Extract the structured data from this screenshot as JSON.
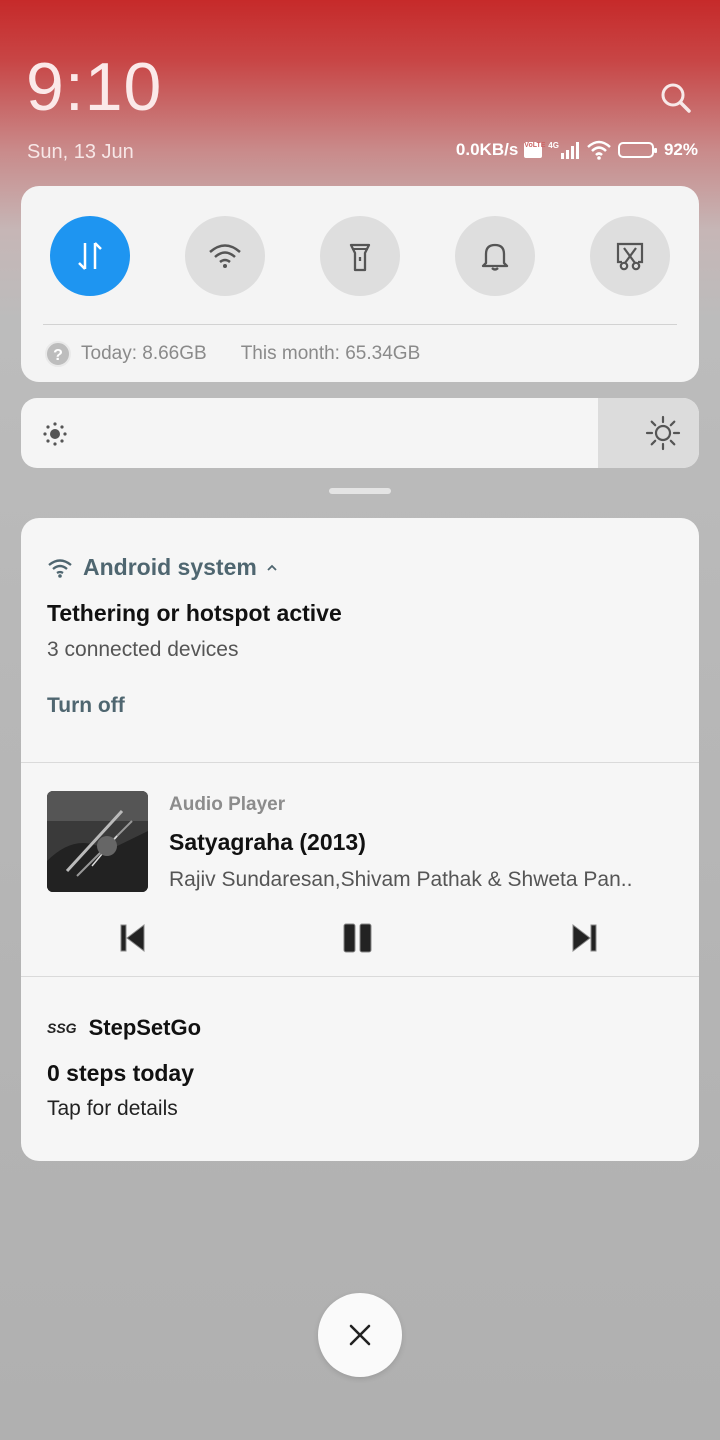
{
  "header": {
    "time": "9:10",
    "date": "Sun, 13 Jun",
    "net_speed": "0.0KB/s",
    "volte_label": "VoLTE",
    "network_type": "4G",
    "battery_percent": "92%",
    "battery_level": 0.92,
    "search_icon": "search-icon"
  },
  "quick_settings": {
    "toggles": [
      {
        "name": "mobile-data",
        "icon": "data-arrows-icon",
        "active": true
      },
      {
        "name": "wifi",
        "icon": "wifi-icon",
        "active": false
      },
      {
        "name": "flashlight",
        "icon": "flashlight-icon",
        "active": false
      },
      {
        "name": "sound",
        "icon": "bell-icon",
        "active": false
      },
      {
        "name": "screenshot",
        "icon": "scissors-screenshot-icon",
        "active": false
      }
    ],
    "data_today": "Today: 8.66GB",
    "data_month": "This month: 65.34GB"
  },
  "brightness": {
    "level": 0.85
  },
  "notifications": {
    "hotspot": {
      "app_name": "Android system",
      "title": "Tethering or hotspot active",
      "text": "3 connected devices",
      "action": "Turn off"
    },
    "media": {
      "app_name": "Audio Player",
      "title": "Satyagraha (2013)",
      "artist": "Rajiv Sundaresan,Shivam Pathak & Shweta Pan.."
    },
    "stepsetgo": {
      "app_logo": "SSG",
      "app_name": "StepSetGo",
      "title": "0 steps today",
      "text": "Tap for details"
    }
  },
  "colors": {
    "accent_blue": "#1e95f1",
    "app_name": "#4f6670"
  }
}
